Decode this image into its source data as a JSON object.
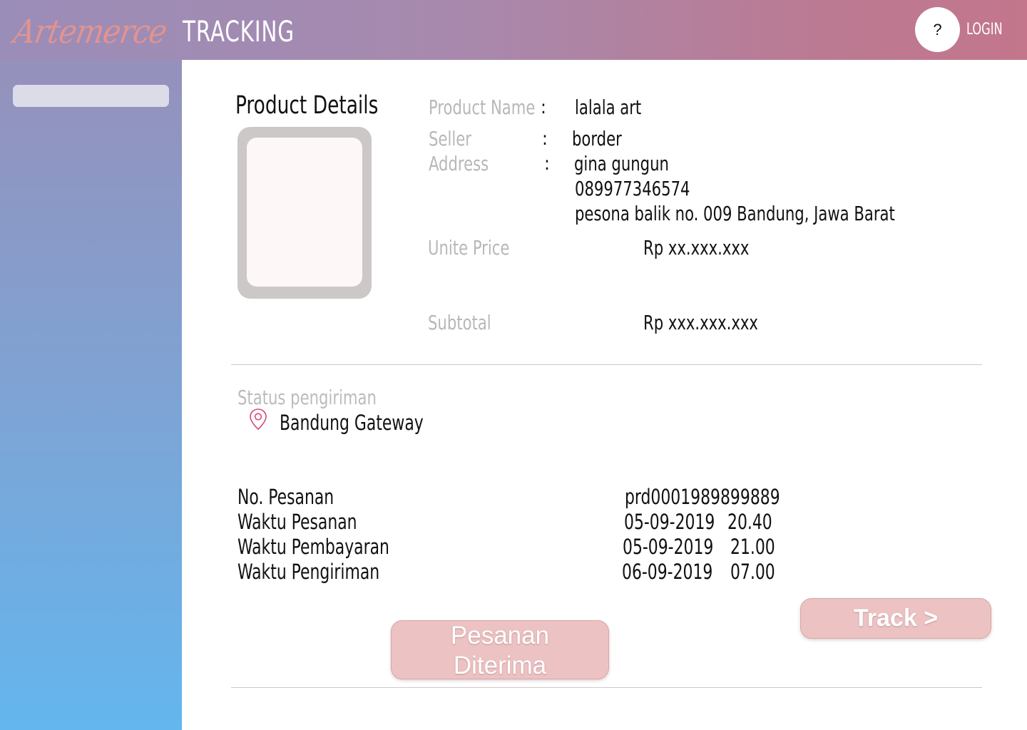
{
  "header": {
    "logo_text": "Artemerce",
    "title": "TRACKING",
    "help_label": "?",
    "login_label": "LOGIN"
  },
  "sidebar": {
    "search": {
      "placeholder": "",
      "value": ""
    }
  },
  "product": {
    "section_title": "Product Details",
    "name_label": "Product Name",
    "name_value": "lalala art",
    "seller_label": "Seller",
    "seller_value": "border",
    "address_label": "Address",
    "address_lines": [
      "gina gungun",
      "089977346574",
      "pesona balik no. 009 Bandung, Jawa Barat"
    ],
    "colon": ":",
    "unit_price_label": "Unite Price",
    "unit_price_value": "Rp xx.xxx.xxx",
    "subtotal_label": "Subtotal",
    "subtotal_value": "Rp xxx.xxx.xxx"
  },
  "status": {
    "label": "Status pengiriman",
    "location": "Bandung Gateway",
    "icon": "location-pin-icon"
  },
  "order": {
    "rows": [
      {
        "label": "No. Pesanan",
        "date": "prd0001989899889",
        "time": ""
      },
      {
        "label": "Waktu Pesanan",
        "date": "05-09-2019",
        "time": "20.40"
      },
      {
        "label": "Waktu Pembayaran",
        "date": "05-09-2019",
        "time": "21.00"
      },
      {
        "label": "Waktu Pengiriman",
        "date": "06-09-2019",
        "time": "07.00"
      }
    ]
  },
  "actions": {
    "received_line1": "Pesanan",
    "received_line2": "Diterima",
    "track_label": "Track >"
  },
  "colors": {
    "header_start": "#9a8db8",
    "header_end": "#c3768c",
    "sidebar_top": "#9591bb",
    "sidebar_bottom": "#63b6ee",
    "button_bg": "#ecc2c3",
    "logo": "#e3938f",
    "pin": "#d9467a"
  }
}
